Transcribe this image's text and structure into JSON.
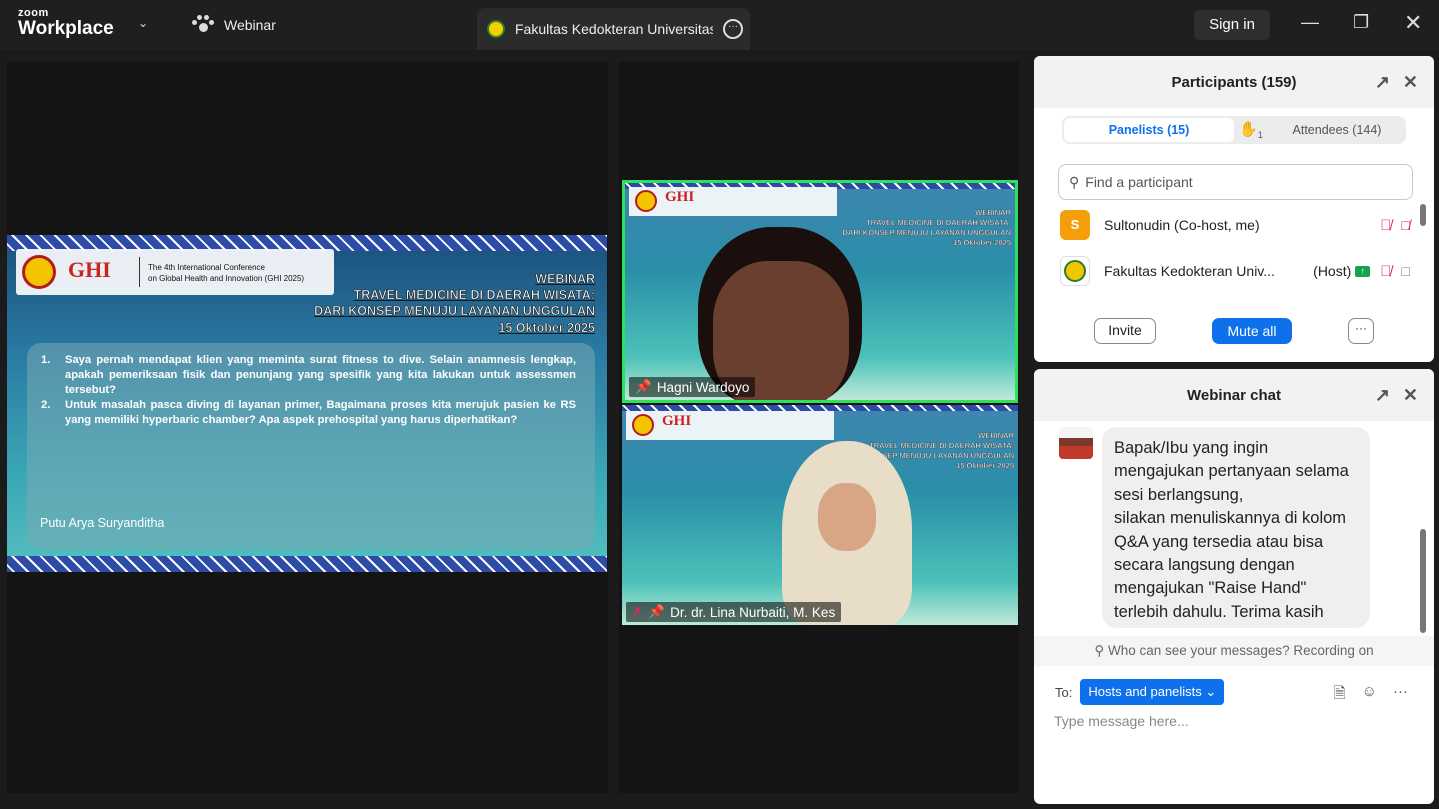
{
  "titlebar": {
    "logo_top": "zoom",
    "logo_bottom": "Workplace",
    "webinar_label": "Webinar",
    "meeting_tab": "Fakultas Kedokteran Universitas M",
    "sign_in": "Sign in"
  },
  "slide": {
    "conference_line1": "The 4th International Conference",
    "conference_line2": "on Global Health and Innovation (GHI 2025)",
    "ghi_logo": "GHI",
    "title1": "WEBINAR",
    "title2": "TRAVEL MEDICINE DI DAERAH WISATA:",
    "title3": "DARI KONSEP MENUJU LAYANAN UNGGULAN",
    "title4": "15 Oktober 2025",
    "questions": [
      {
        "num": "1.",
        "text": "Saya pernah mendapat klien yang meminta surat fitness to dive. Selain anamnesis lengkap, apakah pemeriksaan fisik dan penunjang yang spesifik yang kita lakukan untuk assessmen tersebut?"
      },
      {
        "num": "2.",
        "text": "Untuk masalah pasca diving di layanan primer, Bagaimana proses kita merujuk pasien ke RS yang memiliki hyperbaric chamber? Apa aspek prehospital yang harus diperhatikan?"
      }
    ],
    "speaker": "Putu Arya Suryanditha"
  },
  "videos": [
    {
      "name": "Hagni Wardoyo"
    },
    {
      "name": "Dr. dr. Lina Nurbaiti, M. Kes"
    }
  ],
  "participants": {
    "title": "Participants (159)",
    "tab_panelists": "Panelists (15)",
    "raised_hands": "1",
    "tab_attendees": "Attendees (144)",
    "search_placeholder": "Find a participant",
    "list": [
      {
        "initial": "S",
        "name": "Sultonudin (Co-host, me)",
        "role": ""
      },
      {
        "initial": "",
        "name": "Fakultas Kedokteran Univ...",
        "role": "(Host)"
      }
    ],
    "invite": "Invite",
    "mute_all": "Mute all",
    "more": "···"
  },
  "chat": {
    "title": "Webinar chat",
    "message": "Bapak/Ibu yang ingin\nmengajukan pertanyaan selama\nsesi berlangsung,\nsilakan menuliskannya di kolom\nQ&A yang tersedia atau bisa\nsecara langsung dengan\nmengajukan \"Raise Hand\"\nterlebih dahulu. Terima kasih",
    "who_can_see": "Who can see your messages? Recording on",
    "to_label": "To:",
    "to_value": "Hosts and panelists",
    "input_placeholder": "Type message here..."
  },
  "colors": {
    "accent": "#0e71eb",
    "active_speaker": "#2ee05a",
    "mute_red": "#e0245e"
  }
}
